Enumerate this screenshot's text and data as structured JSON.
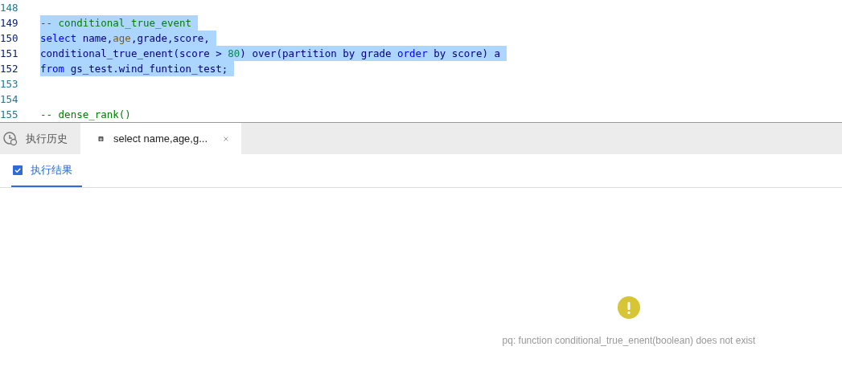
{
  "editor": {
    "lines": [
      {
        "number": "148",
        "selected": false
      },
      {
        "number": "149",
        "selected": true,
        "tokens": [
          {
            "text": "-- conditional_true_event",
            "kind": "comment"
          }
        ]
      },
      {
        "number": "150",
        "selected": true,
        "tokens": [
          {
            "text": "select",
            "kind": "keyword"
          },
          {
            "text": " name,",
            "kind": "plain"
          },
          {
            "text": "age",
            "kind": "builtin"
          },
          {
            "text": ",grade,score,",
            "kind": "plain"
          }
        ]
      },
      {
        "number": "151",
        "selected": true,
        "tokens": [
          {
            "text": "conditional_true_enent(score > ",
            "kind": "plain"
          },
          {
            "text": "80",
            "kind": "number"
          },
          {
            "text": ") over(partition by grade ",
            "kind": "plain"
          },
          {
            "text": "order",
            "kind": "keyword"
          },
          {
            "text": " by score) a",
            "kind": "plain"
          }
        ]
      },
      {
        "number": "152",
        "selected": true,
        "tokens": [
          {
            "text": "from",
            "kind": "keyword"
          },
          {
            "text": " gs_test.wind_funtion_test;",
            "kind": "plain"
          }
        ]
      },
      {
        "number": "153",
        "selected": false
      },
      {
        "number": "154",
        "selected": false
      },
      {
        "number": "155",
        "selected": false,
        "tokens": [
          {
            "text": "-- dense_rank()",
            "kind": "comment"
          }
        ]
      }
    ]
  },
  "tabs": [
    {
      "label": "执行历史",
      "kind": "history",
      "selected": false
    },
    {
      "label": "select name,age,g...",
      "kind": "query",
      "selected": true,
      "closable": true
    }
  ],
  "result_tabs": [
    {
      "label": "执行结果",
      "selected": true
    }
  ],
  "error": {
    "message": "pq: function conditional_true_enent(boolean) does not exist"
  }
}
